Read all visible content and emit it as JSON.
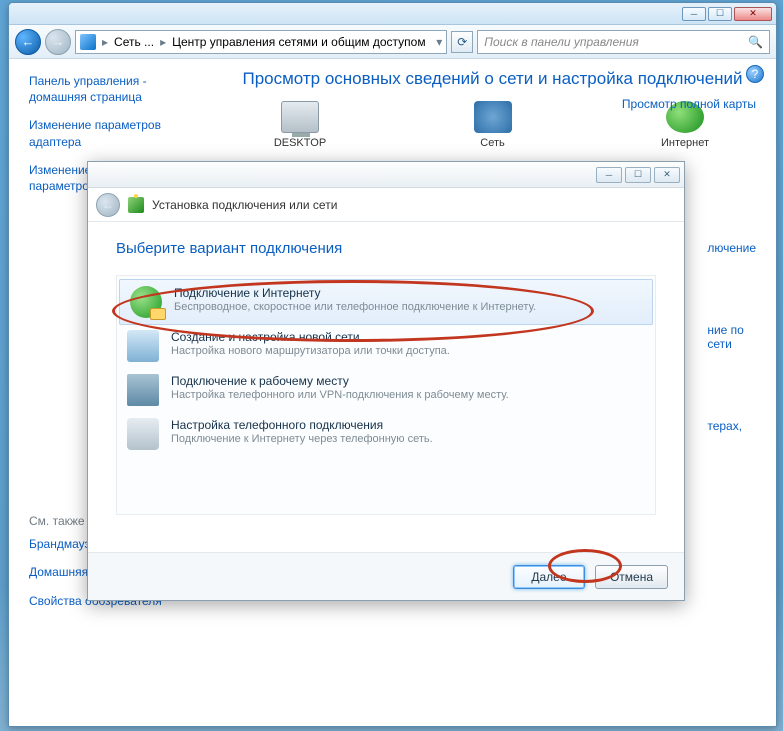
{
  "window": {
    "breadcrumb_root": "Сеть ...",
    "breadcrumb_page": "Центр управления сетями и общим доступом",
    "search_placeholder": "Поиск в панели управления"
  },
  "sidebar": {
    "items": [
      "Панель управления - домашняя страница",
      "Изменение параметров адаптера",
      "Изменение дополнительных параметров общего доступа"
    ],
    "seealso_label": "См. также",
    "seealso_items": [
      "Брандмауэр Windows",
      "Домашняя группа",
      "Свойства обозревателя"
    ]
  },
  "main": {
    "title": "Просмотр основных сведений о сети и настройка подключений",
    "map_link": "Просмотр полной карты",
    "nodes": {
      "desktop": "DESKTOP",
      "net": "Сеть",
      "internet": "Интернет"
    },
    "right_links": {
      "conn": "лючение",
      "by": "ние по\nсети",
      "printers": "терах,"
    }
  },
  "dialog": {
    "title": "Установка подключения или сети",
    "heading": "Выберите вариант подключения",
    "options": [
      {
        "title": "Подключение к Интернету",
        "desc": "Беспроводное, скоростное или телефонное подключение к Интернету."
      },
      {
        "title": "Создание и настройка новой сети",
        "desc": "Настройка нового маршрутизатора или точки доступа."
      },
      {
        "title": "Подключение к рабочему месту",
        "desc": "Настройка телефонного или VPN-подключения к рабочему месту."
      },
      {
        "title": "Настройка телефонного подключения",
        "desc": "Подключение к Интернету через телефонную сеть."
      }
    ],
    "next": "Далее",
    "cancel": "Отмена"
  }
}
